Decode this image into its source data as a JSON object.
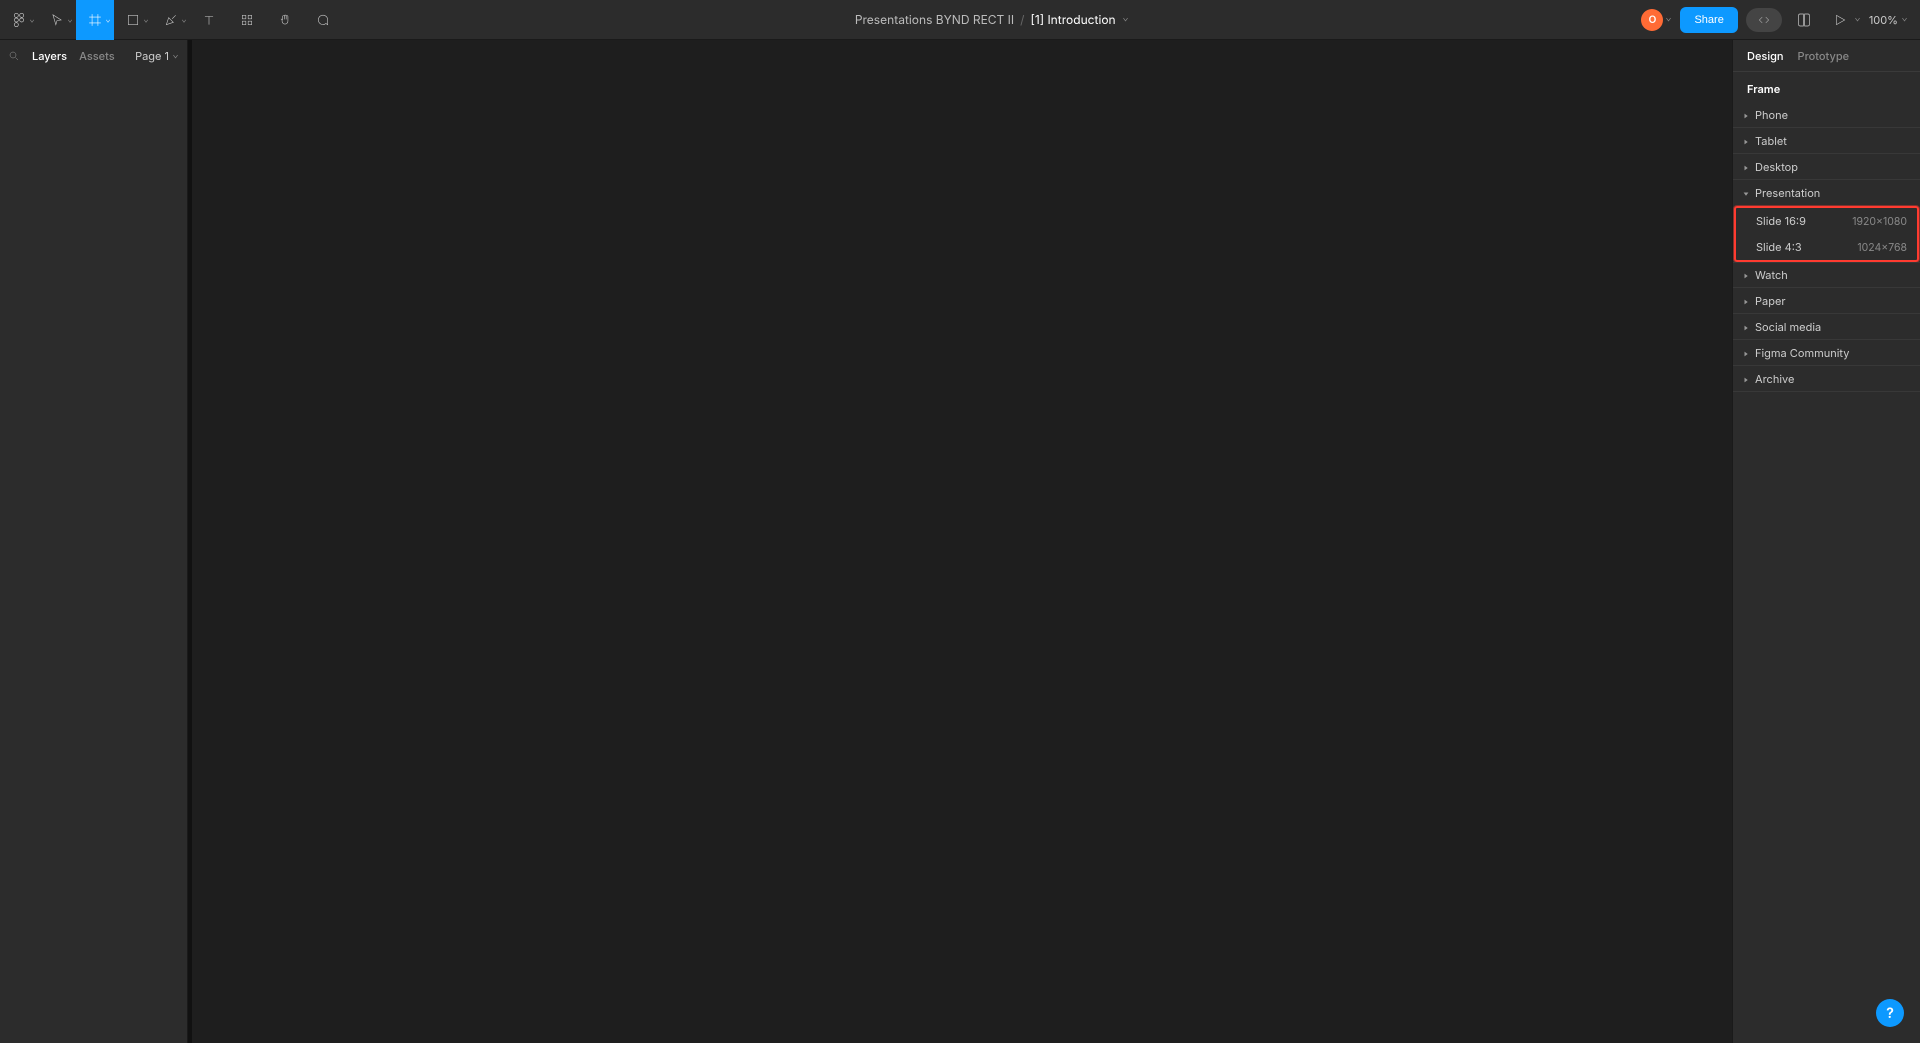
{
  "toolbar": {
    "breadcrumb_parent": "Presentations BYND RECT II",
    "breadcrumb_current": "[1] Introduction",
    "share_label": "Share",
    "zoom": "100%",
    "avatar_letter": "O"
  },
  "left_panel": {
    "tab_layers": "Layers",
    "tab_assets": "Assets",
    "page_label": "Page 1"
  },
  "right_panel": {
    "tab_design": "Design",
    "tab_prototype": "Prototype",
    "section_title": "Frame",
    "presets": {
      "phone": "Phone",
      "tablet": "Tablet",
      "desktop": "Desktop",
      "presentation": "Presentation",
      "watch": "Watch",
      "paper": "Paper",
      "social": "Social media",
      "figma_community": "Figma Community",
      "archive": "Archive"
    },
    "presentation_presets": [
      {
        "name": "Slide 16:9",
        "dims": "1920×1080"
      },
      {
        "name": "Slide 4:3",
        "dims": "1024×768"
      }
    ]
  },
  "help_label": "?"
}
